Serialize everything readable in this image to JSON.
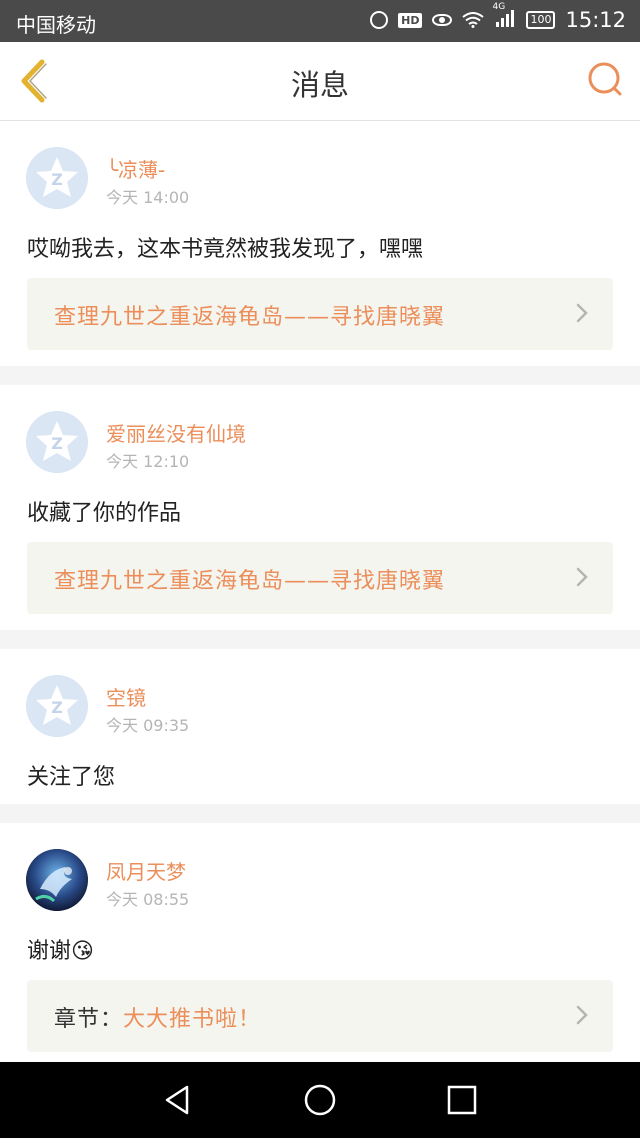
{
  "status_bar": {
    "carrier": "中国移动",
    "hd": "HD",
    "network": "4G",
    "battery": "100",
    "time": "15:12"
  },
  "header": {
    "title": "消息"
  },
  "messages": [
    {
      "username": "╰凉薄-",
      "time": "今天 14:00",
      "text": "哎呦我去，这本书竟然被我发现了，嘿嘿",
      "link": "查理九世之重返海龟岛——寻找唐晓翼"
    },
    {
      "username": "爱丽丝没有仙境",
      "time": "今天 12:10",
      "text": "收藏了你的作品",
      "link": "查理九世之重返海龟岛——寻找唐晓翼"
    },
    {
      "username": "空镜",
      "time": "今天 09:35",
      "text": "关注了您"
    },
    {
      "username": "凤月天梦",
      "time": "今天 08:55",
      "text": "谢谢",
      "emoji": "😘",
      "link_prefix": "章节：",
      "link": "大大推书啦！"
    }
  ],
  "colors": {
    "accent": "#ec8e5a",
    "back_icon": "#e2b230"
  }
}
